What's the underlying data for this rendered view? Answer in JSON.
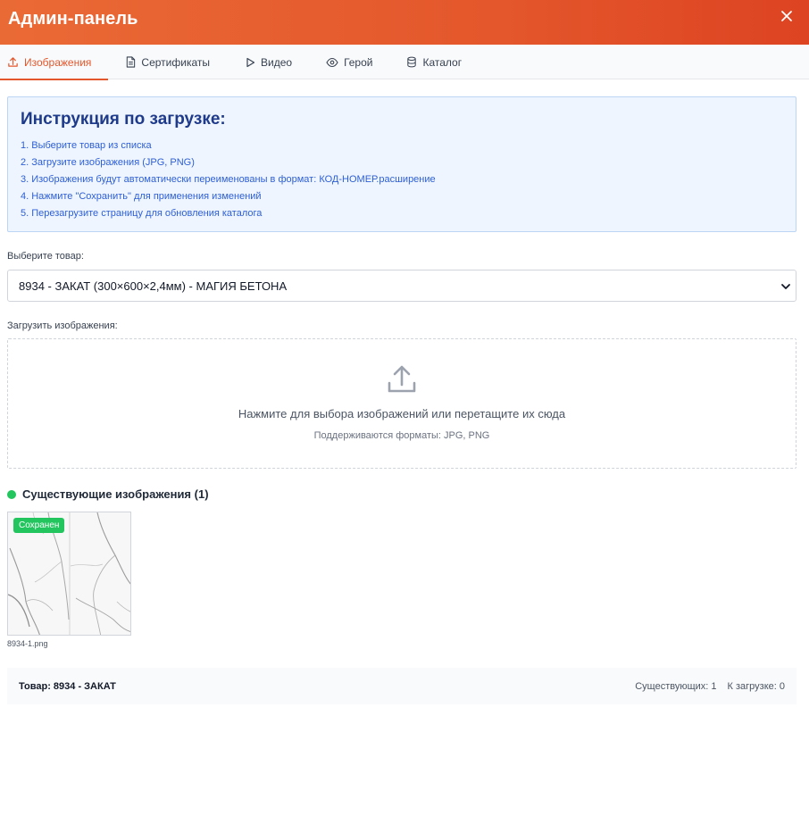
{
  "header": {
    "title": "Админ-панель",
    "close_icon": "close-icon"
  },
  "tabs": [
    {
      "label": "Изображения",
      "icon": "upload-icon",
      "active": true
    },
    {
      "label": "Сертификаты",
      "icon": "document-icon",
      "active": false
    },
    {
      "label": "Видео",
      "icon": "play-icon",
      "active": false
    },
    {
      "label": "Герой",
      "icon": "eye-icon",
      "active": false
    },
    {
      "label": "Каталог",
      "icon": "database-icon",
      "active": false
    }
  ],
  "instructions": {
    "title": "Инструкция по загрузке:",
    "items": [
      "1. Выберите товар из списка",
      "2. Загрузите изображения (JPG, PNG)",
      "3. Изображения будут автоматически переименованы в формат: КОД-НОМЕР.расширение",
      "4. Нажмите \"Сохранить\" для применения изменений",
      "5. Перезагрузите страницу для обновления каталога"
    ]
  },
  "product_select": {
    "label": "Выберите товар:",
    "value": "8934 - ЗАКАТ (300×600×2,4мм) - МАГИЯ БЕТОНА"
  },
  "upload": {
    "label": "Загрузить изображения:",
    "main_text": "Нажмите для выбора изображений или перетащите их сюда",
    "sub_text": "Поддерживаются форматы: JPG, PNG"
  },
  "existing": {
    "title": "Существующие изображения (1)",
    "images": [
      {
        "badge": "Сохранен",
        "filename": "8934-1.png"
      }
    ]
  },
  "footer": {
    "product": "Товар: 8934 - ЗАКАТ",
    "existing_count": "Существующих: 1",
    "upload_count": "К загрузке: 0"
  },
  "colors": {
    "accent": "#e4572c",
    "info_bg": "#eef5fe",
    "info_title": "#1e3a8a",
    "info_text": "#2d5fd6",
    "success": "#22c55e"
  }
}
